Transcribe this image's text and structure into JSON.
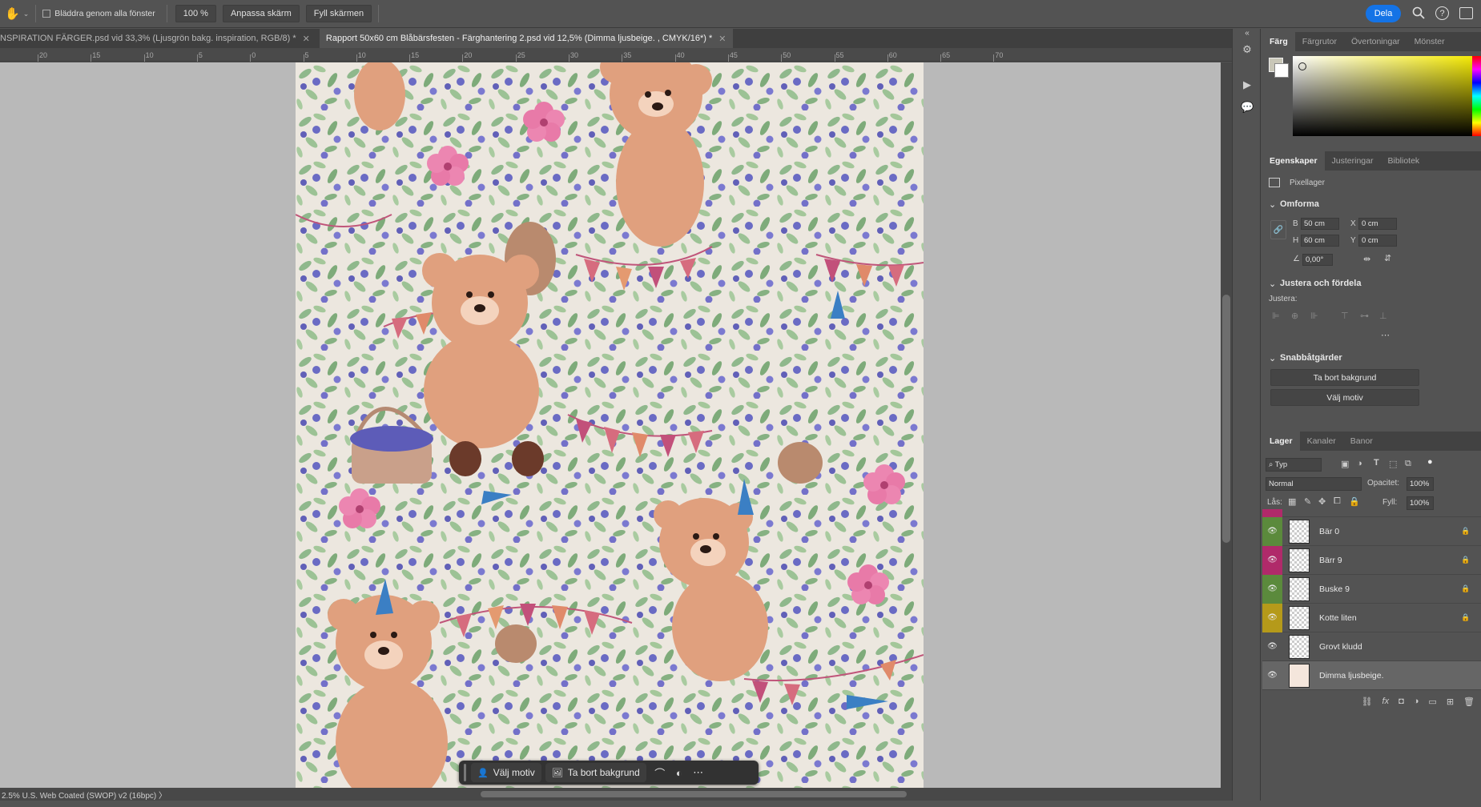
{
  "options_bar": {
    "scroll_all_label": "Bläddra genom alla fönster",
    "zoom_value": "100 %",
    "fit_screen": "Anpassa skärm",
    "fill_screen": "Fyll skärmen",
    "share": "Dela"
  },
  "tabs": [
    {
      "label": "NSPIRATION FÄRGER.psd vid 33,3% (Ljusgrön bakg. inspiration, RGB/8) *"
    },
    {
      "label": "Rapport 50x60 cm Blåbärsfesten - Färghantering 2.psd vid 12,5% (Dimma ljusbeige. , CMYK/16*) *"
    }
  ],
  "ruler": [
    "20",
    "15",
    "10",
    "5",
    "0",
    "5",
    "10",
    "15",
    "20",
    "25",
    "30",
    "35",
    "40",
    "45",
    "50",
    "55",
    "60",
    "65",
    "70"
  ],
  "status": "2.5%  U.S. Web Coated (SWOP) v2 (16bpc)  〉",
  "context_bar": {
    "select_subject": "Välj motiv",
    "remove_bg": "Ta bort bakgrund"
  },
  "color_panel": {
    "tabs": [
      "Färg",
      "Färgrutor",
      "Övertoningar",
      "Mönster"
    ]
  },
  "properties_panel": {
    "tabs": [
      "Egenskaper",
      "Justeringar",
      "Bibliotek"
    ],
    "layer_kind": "Pixellager",
    "transform": {
      "title": "Omforma",
      "w_label": "B",
      "w": "50 cm",
      "h_label": "H",
      "h": "60 cm",
      "x_label": "X",
      "x": "0 cm",
      "y_label": "Y",
      "y": "0 cm",
      "angle": "0,00°"
    },
    "align": {
      "title": "Justera och fördela",
      "sub": "Justera:"
    },
    "quick_actions": {
      "title": "Snabbåtgärder",
      "remove_bg": "Ta bort bakgrund",
      "select_subject": "Välj motiv"
    }
  },
  "layers_panel": {
    "tabs": [
      "Lager",
      "Kanaler",
      "Banor"
    ],
    "filter": "Typ",
    "blend_mode": "Normal",
    "opacity_label": "Opacitet:",
    "opacity": "100%",
    "lock_label": "Lås:",
    "fill_label": "Fyll:",
    "fill": "100%",
    "layers": [
      {
        "name": "Bär 0",
        "color": "#5b8a3c",
        "locked": true
      },
      {
        "name": "Bärr 9",
        "color": "#b02a6a",
        "locked": true
      },
      {
        "name": "Buske 9",
        "color": "#5b8a3c",
        "locked": true
      },
      {
        "name": "Kotte liten",
        "color": "#b59a1a",
        "locked": true
      },
      {
        "name": "Grovt kludd",
        "color": "",
        "locked": false
      },
      {
        "name": "Dimma ljusbeige.",
        "color": "",
        "locked": false
      }
    ]
  },
  "colors": {
    "accent_blue": "#1473e6",
    "canvas_bg": "#ece7df"
  }
}
